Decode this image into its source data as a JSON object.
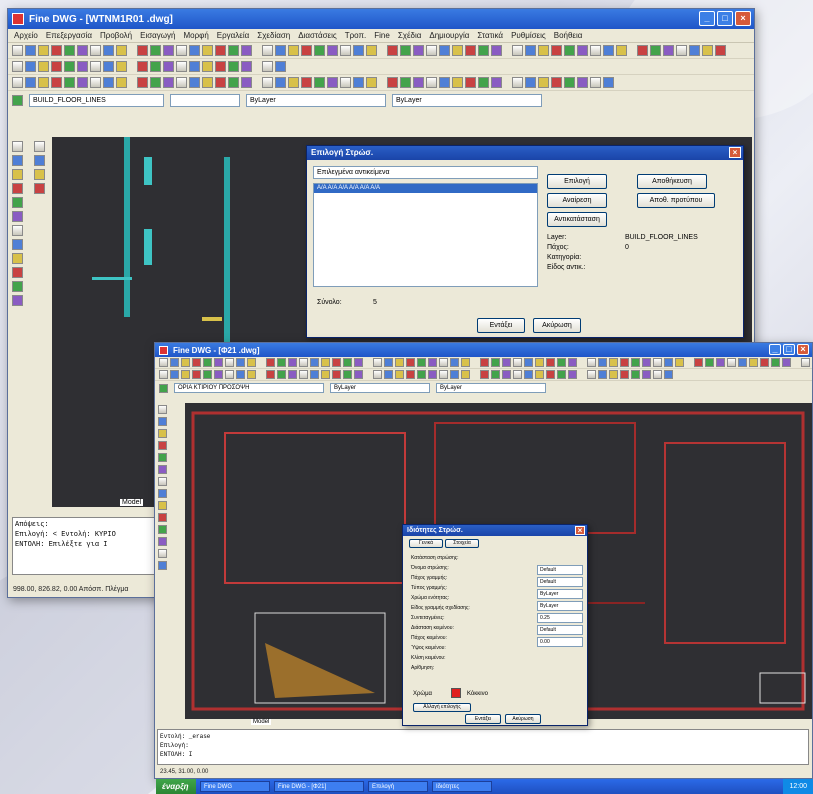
{
  "window1": {
    "title": "Fine DWG - [WTNM1R01 .dwg]",
    "menu": [
      "Αρχείο",
      "Επεξεργασία",
      "Προβολή",
      "Εισαγωγή",
      "Μορφή",
      "Εργαλεία",
      "Σχεδίαση",
      "Διαστάσεις",
      "Τροπ.",
      "Fine",
      "Σχέδια",
      "Δημιουργία",
      "Στατικά",
      "Ρυθμίσεις",
      "Βοήθεια"
    ],
    "layer_combo": "BUILD_FLOOR_LINES",
    "linetype_combo": "ByLayer",
    "lineweight_combo": "ByLayer",
    "cmd_lines": [
      "Απόψεις:",
      "Επιλογή: < Εντολή: ΚΥΡΙΟ",
      "ΕΝΤΟΛΗ: Επιλέξτε για Ι"
    ],
    "model_tab": "Model",
    "status": "998.00, 826.82, 0.00  Απόσπ. Πλέγμα"
  },
  "dialog1": {
    "title": "Επιλογή Στρώσ.",
    "filter_combo": "Επιλεγμένα αντικείμενα",
    "list_row": "Α/Α  Α/Α  Α/Α  Α/Α  Α/Α  Α/Α",
    "buttons": [
      "Επιλογή",
      "Αναίρεση",
      "Αντικατάσταση",
      "Αποθήκευση",
      "Αποθ. προτύπου"
    ],
    "info_labels": [
      "Layer:",
      "Πάχος:",
      "Κατηγορία:",
      "Είδος αντικ.:"
    ],
    "info_values": [
      "BUILD_FLOOR_LINES",
      "0"
    ],
    "count_label": "Σύνολο:",
    "count_value": "5",
    "ok": "Εντάξει",
    "cancel": "Ακύρωση"
  },
  "window2": {
    "title": "Fine DWG - [Φ21 .dwg]",
    "layer_combo": "ΟΡΙΑ ΚΤΙΡΙΟΥ ΠΡΟΣΟΨΗ",
    "linetype_combo": "ByLayer",
    "lineweight_combo": "ByLayer",
    "cmd_lines": [
      "Εντολή: _erase",
      "Επιλογή:",
      "ΕΝΤΟΛΗ: Ι"
    ],
    "model_tab": "Model",
    "status": "23.45, 31.00, 0.00"
  },
  "dialog2": {
    "title": "Ιδιότητες Στρώσ.",
    "tabs": [
      "Γενικά",
      "Στοιχεία"
    ],
    "fields": [
      "Κατάσταση στρώσης:",
      "Όνομα στρώσης:",
      "Πάχος γραμμής:",
      "Τύπος γραμμής:",
      "Χρώμα ενότητας:",
      "Είδος γραμμής σχεδίασης:",
      "Συντεταγμένες:",
      "Διάσταση κειμένου:",
      "Πάχος κειμένου:",
      "Ύψος κειμένου:",
      "Κλίση κειμένου:",
      "Αρίθμηση:"
    ],
    "values": [
      "Default",
      "Default",
      "ByLayer",
      "ByLayer",
      "0.25",
      "Default",
      "0.00"
    ],
    "color_label": "Χρώμα",
    "color_value": "Κόκκινο",
    "color_hex": "#e01e1e",
    "btn_select": "Αλλαγή επιλογής",
    "ok": "Εντάξει",
    "cancel": "Ακύρωση"
  },
  "taskbar": {
    "start": "έναρξη",
    "items": [
      "Fine DWG",
      "Fine DWG - [Φ21]",
      "Επιλογή",
      "Ιδιότητες"
    ],
    "tray": "12:00"
  }
}
